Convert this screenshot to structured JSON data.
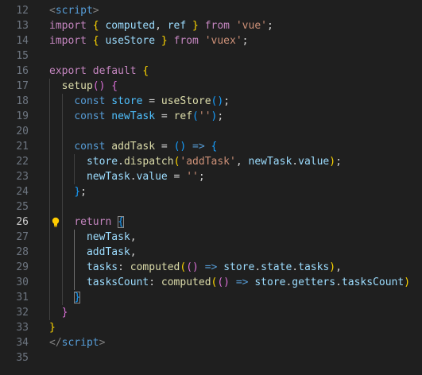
{
  "editor": {
    "language": "vue",
    "active_line": 26,
    "lines": [
      {
        "num": "12",
        "tokens": [
          [
            "tok-punct",
            "<"
          ],
          [
            "tok-tag",
            "script"
          ],
          [
            "tok-punct",
            ">"
          ]
        ]
      },
      {
        "num": "13",
        "tokens": [
          [
            "tok-kw",
            "import"
          ],
          [
            "tok-plain",
            " "
          ],
          [
            "tok-b1",
            "{"
          ],
          [
            "tok-plain",
            " "
          ],
          [
            "tok-var",
            "computed"
          ],
          [
            "tok-plain",
            ", "
          ],
          [
            "tok-var",
            "ref"
          ],
          [
            "tok-plain",
            " "
          ],
          [
            "tok-b1",
            "}"
          ],
          [
            "tok-plain",
            " "
          ],
          [
            "tok-kw",
            "from"
          ],
          [
            "tok-plain",
            " "
          ],
          [
            "tok-str",
            "'vue'"
          ],
          [
            "tok-plain",
            ";"
          ]
        ]
      },
      {
        "num": "14",
        "tokens": [
          [
            "tok-kw",
            "import"
          ],
          [
            "tok-plain",
            " "
          ],
          [
            "tok-b1",
            "{"
          ],
          [
            "tok-plain",
            " "
          ],
          [
            "tok-var",
            "useStore"
          ],
          [
            "tok-plain",
            " "
          ],
          [
            "tok-b1",
            "}"
          ],
          [
            "tok-plain",
            " "
          ],
          [
            "tok-kw",
            "from"
          ],
          [
            "tok-plain",
            " "
          ],
          [
            "tok-str",
            "'vuex'"
          ],
          [
            "tok-plain",
            ";"
          ]
        ]
      },
      {
        "num": "15",
        "tokens": []
      },
      {
        "num": "16",
        "tokens": [
          [
            "tok-kw",
            "export"
          ],
          [
            "tok-plain",
            " "
          ],
          [
            "tok-kw",
            "default"
          ],
          [
            "tok-plain",
            " "
          ],
          [
            "tok-b1",
            "{"
          ]
        ]
      },
      {
        "num": "17",
        "tokens": [
          [
            "tok-plain",
            "  "
          ],
          [
            "tok-fn",
            "setup"
          ],
          [
            "tok-b2",
            "()"
          ],
          [
            "tok-plain",
            " "
          ],
          [
            "tok-b2",
            "{"
          ]
        ]
      },
      {
        "num": "18",
        "tokens": [
          [
            "tok-plain",
            "    "
          ],
          [
            "tok-decl",
            "const"
          ],
          [
            "tok-plain",
            " "
          ],
          [
            "tok-const",
            "store"
          ],
          [
            "tok-plain",
            " = "
          ],
          [
            "tok-fn",
            "useStore"
          ],
          [
            "tok-b3",
            "()"
          ],
          [
            "tok-plain",
            ";"
          ]
        ]
      },
      {
        "num": "19",
        "tokens": [
          [
            "tok-plain",
            "    "
          ],
          [
            "tok-decl",
            "const"
          ],
          [
            "tok-plain",
            " "
          ],
          [
            "tok-const",
            "newTask"
          ],
          [
            "tok-plain",
            " = "
          ],
          [
            "tok-fn",
            "ref"
          ],
          [
            "tok-b3",
            "("
          ],
          [
            "tok-str",
            "''"
          ],
          [
            "tok-b3",
            ")"
          ],
          [
            "tok-plain",
            ";"
          ]
        ]
      },
      {
        "num": "20",
        "tokens": []
      },
      {
        "num": "21",
        "tokens": [
          [
            "tok-plain",
            "    "
          ],
          [
            "tok-decl",
            "const"
          ],
          [
            "tok-plain",
            " "
          ],
          [
            "tok-fn",
            "addTask"
          ],
          [
            "tok-plain",
            " = "
          ],
          [
            "tok-b3",
            "()"
          ],
          [
            "tok-plain",
            " "
          ],
          [
            "tok-decl",
            "=>"
          ],
          [
            "tok-plain",
            " "
          ],
          [
            "tok-b3",
            "{"
          ]
        ]
      },
      {
        "num": "22",
        "tokens": [
          [
            "tok-plain",
            "      "
          ],
          [
            "tok-var",
            "store"
          ],
          [
            "tok-plain",
            "."
          ],
          [
            "tok-fn",
            "dispatch"
          ],
          [
            "tok-b1",
            "("
          ],
          [
            "tok-str",
            "'addTask'"
          ],
          [
            "tok-plain",
            ", "
          ],
          [
            "tok-var",
            "newTask"
          ],
          [
            "tok-plain",
            "."
          ],
          [
            "tok-var",
            "value"
          ],
          [
            "tok-b1",
            ")"
          ],
          [
            "tok-plain",
            ";"
          ]
        ]
      },
      {
        "num": "23",
        "tokens": [
          [
            "tok-plain",
            "      "
          ],
          [
            "tok-var",
            "newTask"
          ],
          [
            "tok-plain",
            "."
          ],
          [
            "tok-var",
            "value"
          ],
          [
            "tok-plain",
            " = "
          ],
          [
            "tok-str",
            "''"
          ],
          [
            "tok-plain",
            ";"
          ]
        ]
      },
      {
        "num": "24",
        "tokens": [
          [
            "tok-plain",
            "    "
          ],
          [
            "tok-b3",
            "}"
          ],
          [
            "tok-plain",
            ";"
          ]
        ]
      },
      {
        "num": "25",
        "tokens": []
      },
      {
        "num": "26",
        "tokens": [
          [
            "tok-plain",
            "    "
          ],
          [
            "tok-kw",
            "return"
          ],
          [
            "tok-plain",
            " "
          ],
          [
            "tok-b3 bracket-box",
            "{"
          ]
        ]
      },
      {
        "num": "27",
        "tokens": [
          [
            "tok-plain",
            "      "
          ],
          [
            "tok-var",
            "newTask"
          ],
          [
            "tok-plain",
            ","
          ]
        ]
      },
      {
        "num": "28",
        "tokens": [
          [
            "tok-plain",
            "      "
          ],
          [
            "tok-var",
            "addTask"
          ],
          [
            "tok-plain",
            ","
          ]
        ]
      },
      {
        "num": "29",
        "tokens": [
          [
            "tok-plain",
            "      "
          ],
          [
            "tok-var",
            "tasks"
          ],
          [
            "tok-plain",
            ": "
          ],
          [
            "tok-fn",
            "computed"
          ],
          [
            "tok-b1",
            "("
          ],
          [
            "tok-b2",
            "()"
          ],
          [
            "tok-plain",
            " "
          ],
          [
            "tok-decl",
            "=>"
          ],
          [
            "tok-plain",
            " "
          ],
          [
            "tok-var",
            "store"
          ],
          [
            "tok-plain",
            "."
          ],
          [
            "tok-var",
            "state"
          ],
          [
            "tok-plain",
            "."
          ],
          [
            "tok-var",
            "tasks"
          ],
          [
            "tok-b1",
            ")"
          ],
          [
            "tok-plain",
            ","
          ]
        ]
      },
      {
        "num": "30",
        "tokens": [
          [
            "tok-plain",
            "      "
          ],
          [
            "tok-var",
            "tasksCount"
          ],
          [
            "tok-plain",
            ": "
          ],
          [
            "tok-fn",
            "computed"
          ],
          [
            "tok-b1",
            "("
          ],
          [
            "tok-b2",
            "()"
          ],
          [
            "tok-plain",
            " "
          ],
          [
            "tok-decl",
            "=>"
          ],
          [
            "tok-plain",
            " "
          ],
          [
            "tok-var",
            "store"
          ],
          [
            "tok-plain",
            "."
          ],
          [
            "tok-var",
            "getters"
          ],
          [
            "tok-plain",
            "."
          ],
          [
            "tok-var",
            "tasksCount"
          ],
          [
            "tok-b1",
            ")"
          ]
        ]
      },
      {
        "num": "31",
        "tokens": [
          [
            "tok-plain",
            "    "
          ],
          [
            "tok-b3 bracket-box",
            "}"
          ]
        ]
      },
      {
        "num": "32",
        "tokens": [
          [
            "tok-plain",
            "  "
          ],
          [
            "tok-b2",
            "}"
          ]
        ]
      },
      {
        "num": "33",
        "tokens": [
          [
            "tok-b1",
            "}"
          ]
        ]
      },
      {
        "num": "34",
        "tokens": [
          [
            "tok-punct",
            "</"
          ],
          [
            "tok-tag",
            "script"
          ],
          [
            "tok-punct",
            ">"
          ]
        ]
      },
      {
        "num": "35",
        "tokens": []
      }
    ],
    "lightbulb_icon": "lightbulb-icon",
    "colors": {
      "background": "#1f1f1f",
      "line_number": "#6e7681",
      "keyword": "#c586c0",
      "string": "#ce9178",
      "variable": "#9cdcfe",
      "function": "#dcdcaa",
      "bracket_1": "#ffd700",
      "bracket_2": "#da70d6",
      "bracket_3": "#179fff"
    }
  }
}
